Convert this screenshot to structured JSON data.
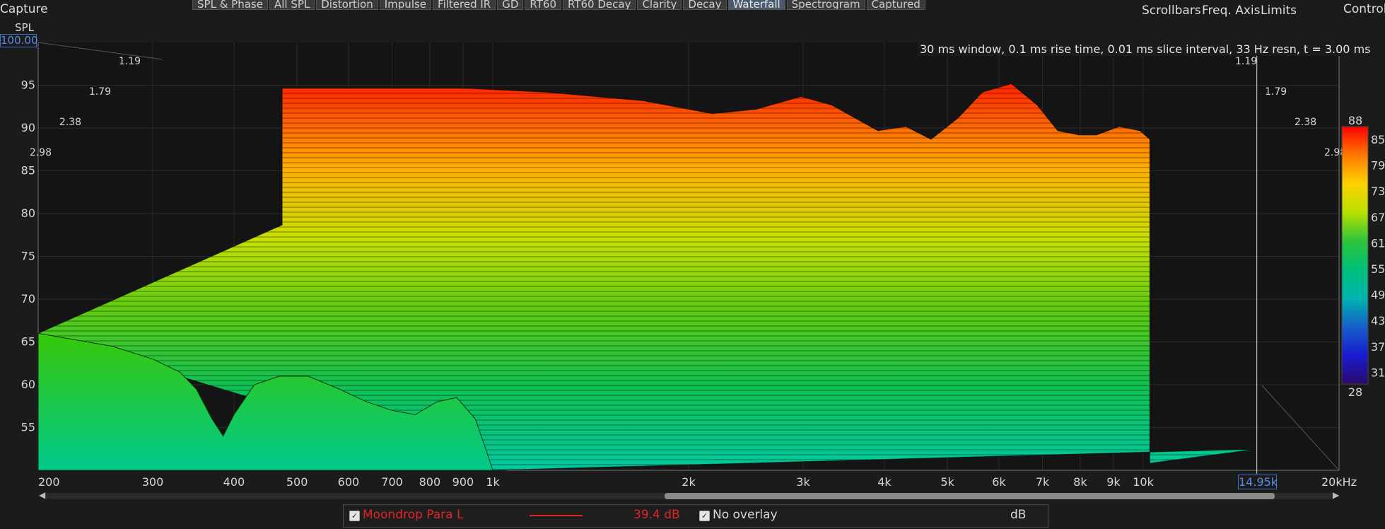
{
  "window": {
    "capture_label": "Capture",
    "controls_label": "Controls"
  },
  "tabs": [
    {
      "label": "SPL & Phase",
      "active": false
    },
    {
      "label": "All SPL",
      "active": false
    },
    {
      "label": "Distortion",
      "active": false
    },
    {
      "label": "Impulse",
      "active": false
    },
    {
      "label": "Filtered IR",
      "active": false
    },
    {
      "label": "GD",
      "active": false
    },
    {
      "label": "RT60",
      "active": false
    },
    {
      "label": "RT60 Decay",
      "active": false
    },
    {
      "label": "Clarity",
      "active": false
    },
    {
      "label": "Decay",
      "active": false
    },
    {
      "label": "Waterfall",
      "active": true
    },
    {
      "label": "Spectrogram",
      "active": false
    },
    {
      "label": "Captured",
      "active": false
    }
  ],
  "toolbar": {
    "scrollbars": "Scrollbars",
    "freq_axis": "Freq. Axis",
    "limits": "Limits"
  },
  "chart_data": {
    "type": "area",
    "subtype": "waterfall-3d",
    "ylabel": "SPL",
    "y_top_value": "100.00",
    "info_text": "30 ms window, 0.1 ms rise time, 0.01 ms slice interval, 33 Hz resn, t = 3.00 ms",
    "x_scale": "log",
    "xlim": [
      200,
      20000
    ],
    "x_ticks": [
      {
        "v": 200,
        "label": "200"
      },
      {
        "v": 300,
        "label": "300"
      },
      {
        "v": 400,
        "label": "400"
      },
      {
        "v": 500,
        "label": "500"
      },
      {
        "v": 600,
        "label": "600"
      },
      {
        "v": 700,
        "label": "700"
      },
      {
        "v": 800,
        "label": "800"
      },
      {
        "v": 900,
        "label": "900"
      },
      {
        "v": 1000,
        "label": "1k"
      },
      {
        "v": 2000,
        "label": "2k"
      },
      {
        "v": 3000,
        "label": "3k"
      },
      {
        "v": 4000,
        "label": "4k"
      },
      {
        "v": 5000,
        "label": "5k"
      },
      {
        "v": 6000,
        "label": "6k"
      },
      {
        "v": 7000,
        "label": "7k"
      },
      {
        "v": 8000,
        "label": "8k"
      },
      {
        "v": 9000,
        "label": "9k"
      },
      {
        "v": 10000,
        "label": "10k"
      },
      {
        "v": 20000,
        "label": "20kHz"
      }
    ],
    "ylim": [
      50,
      100
    ],
    "y_ticks": [
      55,
      60,
      65,
      70,
      75,
      80,
      85,
      90,
      95
    ],
    "time_axis_ms": [
      "1.19",
      "1.79",
      "2.38",
      "2.98"
    ],
    "cursor": {
      "freq": 14950,
      "label": "14.95k"
    },
    "colorbar": {
      "max_label": "88",
      "min_label": "28",
      "labels": [
        "85",
        "79",
        "73",
        "67",
        "61",
        "55",
        "49",
        "43",
        "37",
        "31"
      ],
      "colors": [
        "#ff0000",
        "#ff7a00",
        "#ffd200",
        "#b8e000",
        "#2ec43a",
        "#00c07a",
        "#00b3b0",
        "#1560c8",
        "#1a1ad0",
        "#2a0a6a"
      ]
    },
    "series": [
      {
        "name": "Moondrop Para L",
        "front_slice_freq": [
          200,
          260,
          300,
          330,
          350,
          370,
          385,
          400,
          430,
          470,
          520,
          580,
          640,
          700,
          760,
          820,
          880,
          940,
          980,
          1000
        ],
        "front_slice_db": [
          66,
          64.5,
          63,
          61.5,
          59.5,
          56,
          54,
          56.5,
          60,
          61,
          61,
          59.5,
          58,
          57,
          56.5,
          58,
          58.5,
          56,
          52,
          50
        ],
        "first_slice_freq": [
          330,
          700,
          1000,
          1500,
          2000,
          2400,
          2900,
          3300,
          4000,
          4500,
          5000,
          5600,
          6200,
          7000,
          7800,
          8500,
          9300,
          10000,
          11000,
          12000,
          12500
        ],
        "first_slice_db": [
          96,
          96,
          95.5,
          94.5,
          93,
          93.5,
          95,
          94,
          91,
          91.5,
          90,
          92.5,
          95.5,
          96.5,
          94,
          91,
          90.5,
          90.5,
          91.5,
          91,
          90
        ]
      }
    ]
  },
  "legend": {
    "series_name": "Moondrop Para L",
    "series_color": "#e02424",
    "value": "39.4 dB",
    "overlay": "No overlay",
    "unit": "dB"
  }
}
